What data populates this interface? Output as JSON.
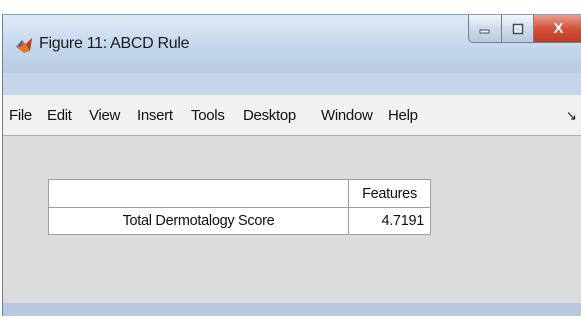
{
  "window": {
    "title": "Figure 11: ABCD Rule",
    "controls": {
      "minimize": "—",
      "maximize": "□",
      "close": "X"
    }
  },
  "menu": {
    "items": [
      "File",
      "Edit",
      "View",
      "Insert",
      "Tools",
      "Desktop",
      "Window",
      "Help"
    ],
    "dock_arrow": "↘"
  },
  "table": {
    "column_header": "Features",
    "rows": [
      {
        "label": "Total Dermotalogy Score",
        "value": "4.7191"
      }
    ]
  },
  "colors": {
    "titlebar": "#c9daee",
    "close_button": "#d1533c",
    "menubar": "#f1f1f1",
    "canvas": "#dcdcdc"
  }
}
